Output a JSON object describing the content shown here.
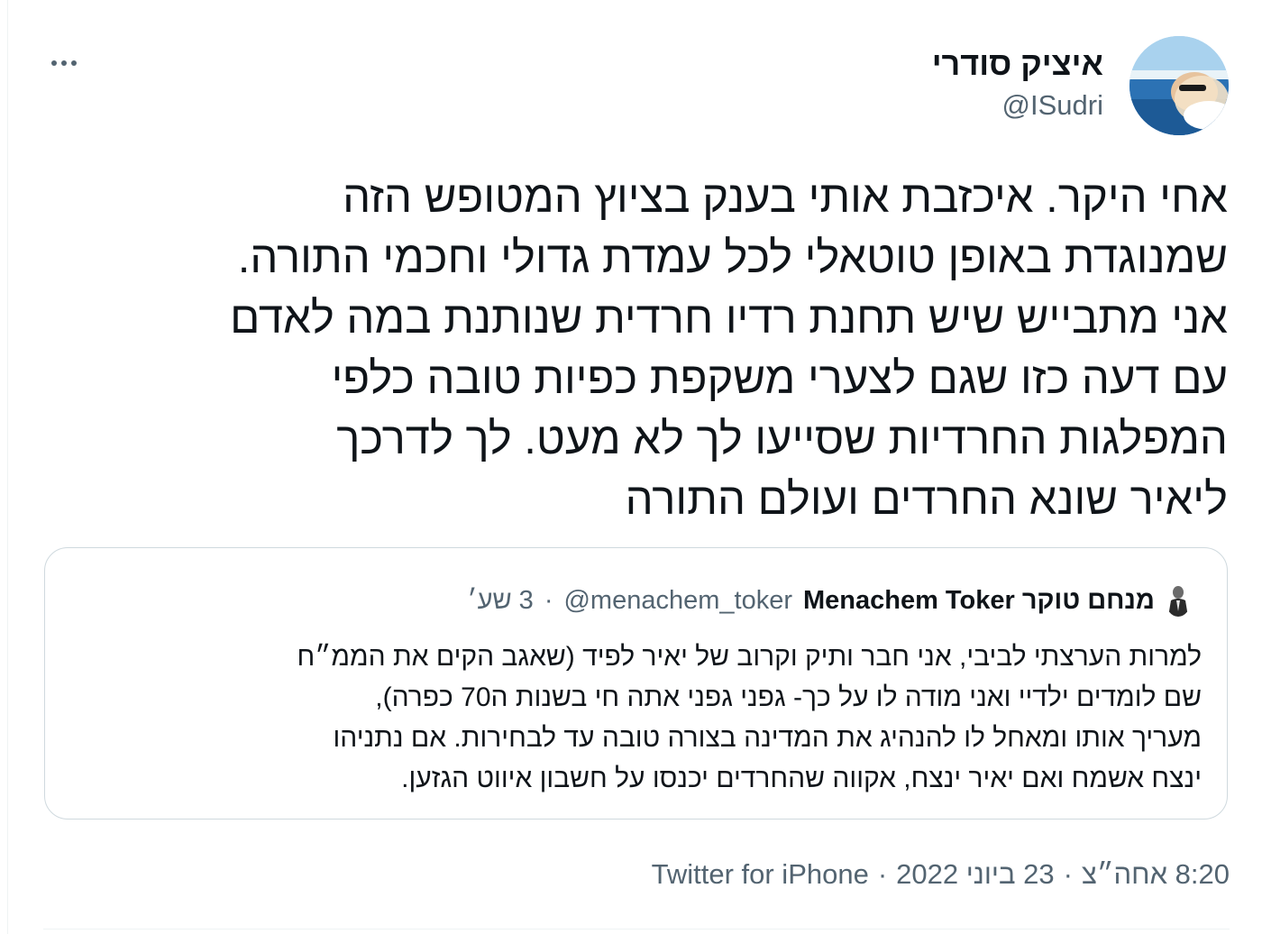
{
  "tweet": {
    "author_name": "איציק סודרי",
    "author_handle": "@ISudri",
    "text_lines": [
      "אחי היקר. איכזבת אותי בענק בציוץ המטופש הזה",
      "שמנוגדת באופן טוטאלי לכל עמדת גדולי וחכמי התורה.",
      "אני מתבייש שיש תחנת רדיו חרדית שנותנת במה לאדם",
      "עם דעה כזו שגם לצערי משקפת כפיות טובה כלפי",
      "המפלגות החרדיות שסייעו לך לא מעט. לך לדרכך",
      "ליאיר שונא החרדים ועולם התורה"
    ],
    "more_icon": "more-horizontal-icon"
  },
  "quote": {
    "name": "Menachem Toker מנחם טוקר",
    "handle": "@menachem_toker",
    "separator": "·",
    "time": "3 שע׳",
    "text_lines": [
      "למרות הערצתי לביבי, אני חבר ותיק וקרוב של יאיר לפיד (שאגב הקים את הממ״ח",
      "שם לומדים ילדיי ואני מודה לו על כך- גפני גפני אתה חי בשנות ה70 כפרה),",
      "מעריך אותו ומאחל לו להנהיג את המדינה בצורה טובה עד לבחירות. אם נתניהו",
      "ינצח אשמח ואם יאיר ינצח, אקווה שהחרדים יכנסו על חשבון איווט הגזען."
    ]
  },
  "meta": {
    "time": "8:20 אחה״צ",
    "separator1": "·",
    "date": "23 ביוני 2022",
    "separator2": "·",
    "source": "Twitter for iPhone"
  }
}
